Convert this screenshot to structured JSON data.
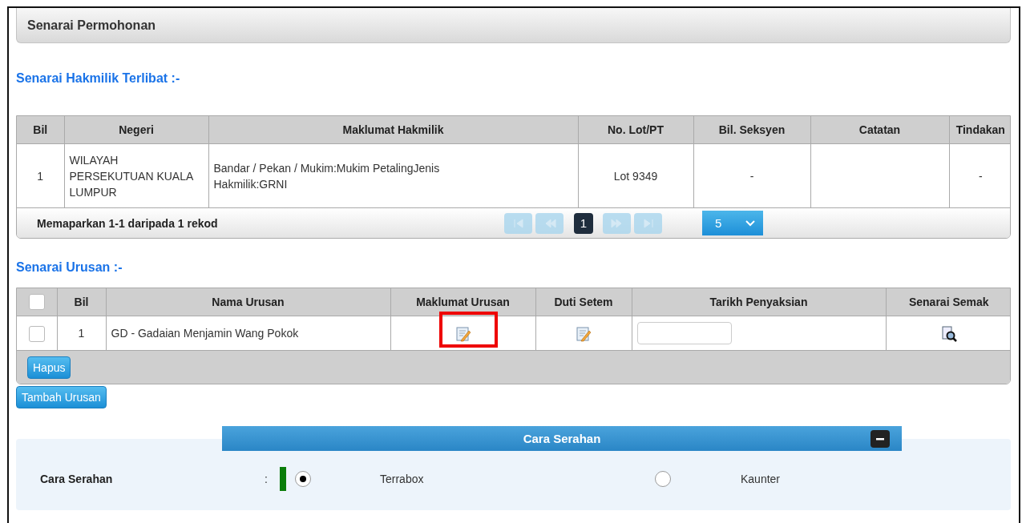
{
  "panel_title": "Senarai Permohonan",
  "hakmilik": {
    "heading": "Senarai Hakmilik Terlibat :-",
    "columns": [
      "Bil",
      "Negeri",
      "Maklumat Hakmilik",
      "No. Lot/PT",
      "Bil. Seksyen",
      "Catatan",
      "Tindakan"
    ],
    "rows": [
      {
        "bil": "1",
        "negeri": "WILAYAH PERSEKUTUAN KUALA LUMPUR",
        "maklumat": [
          "Bandar / Pekan / Mukim:Mukim PetalingJenis",
          "Hakmilik:GRNI"
        ],
        "lot": "Lot 9349",
        "seksyen": "-",
        "tindakan": "-"
      }
    ],
    "summary": "Memaparkan 1-1 daripada 1 rekod",
    "pager": [
      {
        "kind": "first",
        "disabled": true
      },
      {
        "kind": "prev",
        "disabled": true
      },
      {
        "kind": "page",
        "label": "1",
        "selected": true
      },
      {
        "kind": "next",
        "disabled": true
      },
      {
        "kind": "last",
        "disabled": true
      }
    ],
    "page_size": "5"
  },
  "urusan": {
    "heading": "Senarai Urusan :-",
    "select_all": {
      "checked": false
    },
    "columns": [
      "Bil",
      "Nama Urusan",
      "Maklumat Urusan",
      "Duti Setem",
      "Tarikh Penyaksian",
      "Senarai Semak"
    ],
    "rows": [
      {
        "checked": false,
        "bil": "1",
        "nama": "GD - Gadaian Menjamin Wang Pokok",
        "maklumat_highlighted": true
      }
    ],
    "delete_button": "Hapus",
    "add_button": "Tambah Urusan"
  },
  "cara_serahan": {
    "title": "Cara Serahan",
    "expanded": true,
    "label": "Cara Serahan",
    "separator": ":",
    "required": true,
    "options": [
      {
        "label": "Terrabox",
        "selected": true
      },
      {
        "label": "Kaunter",
        "selected": false
      }
    ]
  }
}
